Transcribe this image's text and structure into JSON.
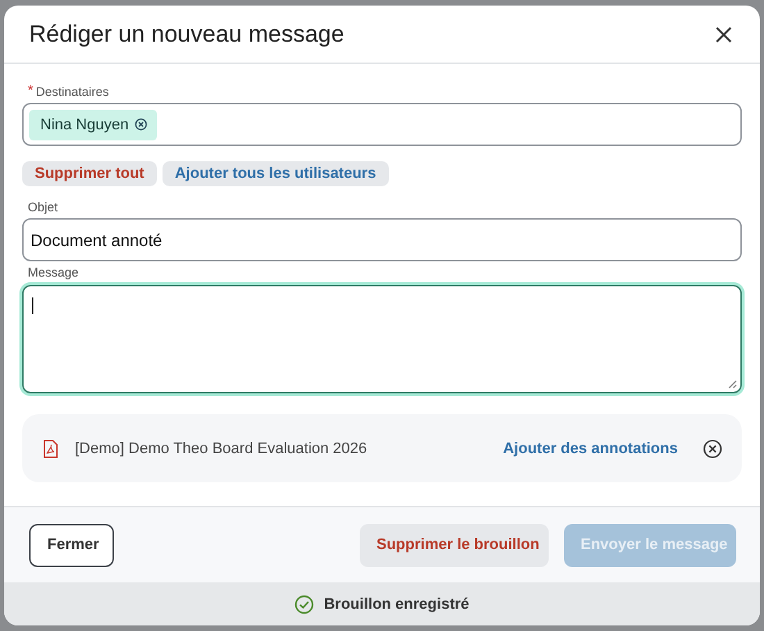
{
  "dialog": {
    "title": "Rédiger un nouveau message"
  },
  "recipients": {
    "label": "Destinataires",
    "required_mark": "*",
    "chips": [
      {
        "name": "Nina Nguyen"
      }
    ]
  },
  "recipient_actions": [
    {
      "label": "Supprimer tout",
      "kind": "danger"
    },
    {
      "label": "Ajouter tous les utilisateurs",
      "kind": "primary"
    }
  ],
  "subject": {
    "label": "Objet",
    "value": "Document annoté"
  },
  "message": {
    "label": "Message",
    "focused": true
  },
  "attachments": [
    {
      "name": "[Demo] Demo Theo Board Evaluation 2026",
      "action": "Ajouter des annotations"
    }
  ],
  "footer_buttons": [
    {
      "label": "Fermer",
      "kind": "outline",
      "disabled": false
    },
    {
      "label": "Supprimer le brouillon",
      "kind": "danger",
      "disabled": false
    },
    {
      "label": "Envoyer le message",
      "kind": "primary",
      "disabled": true
    }
  ],
  "status_bar": {
    "text": "Brouillon enregistré"
  }
}
